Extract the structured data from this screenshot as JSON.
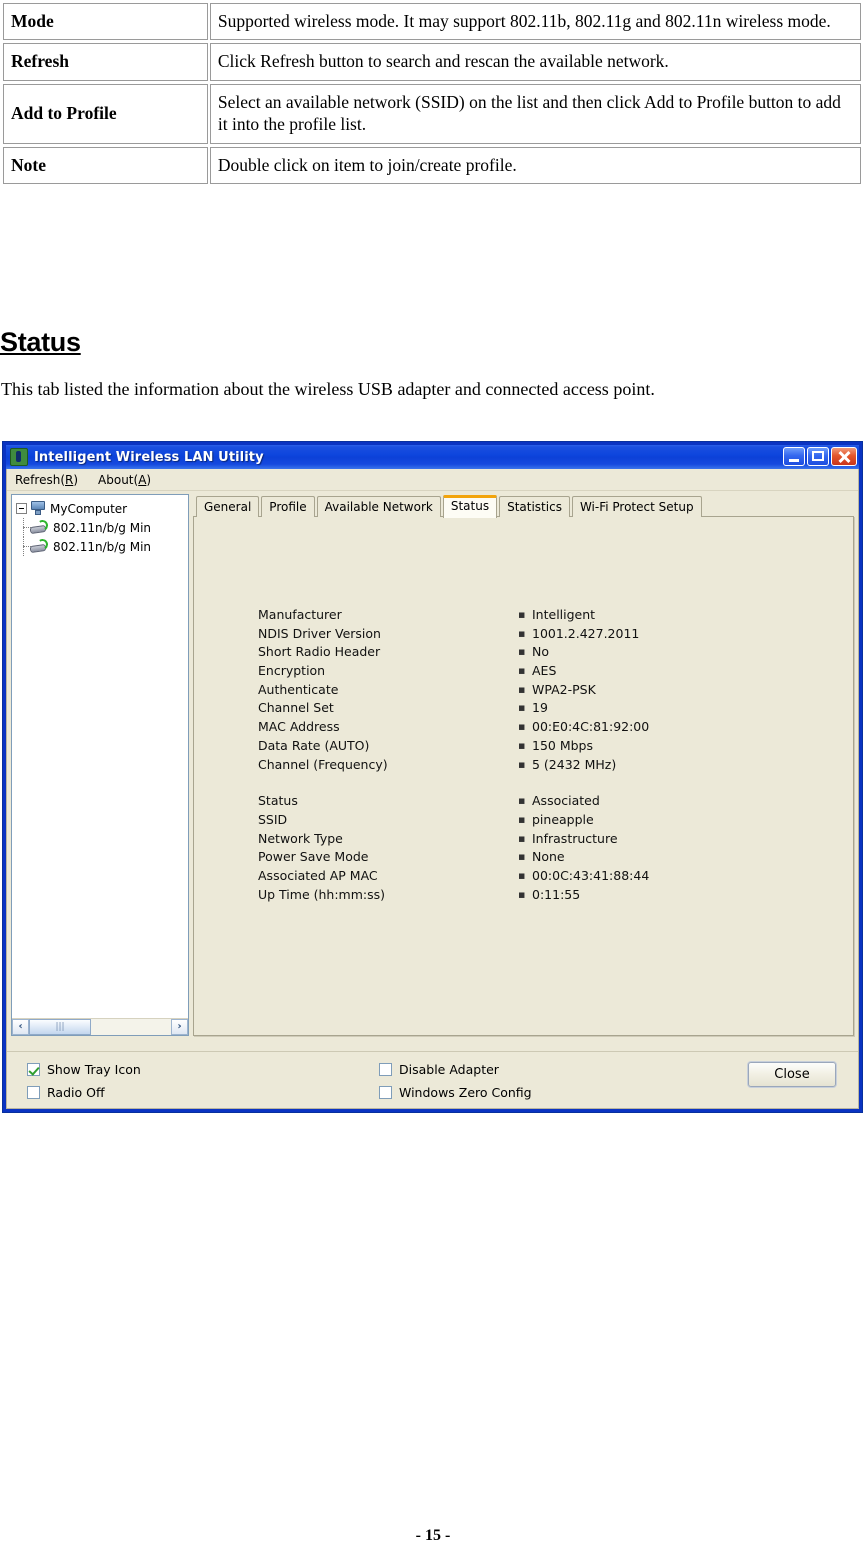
{
  "doc_table": {
    "rows": [
      {
        "term": "Mode",
        "description": "Supported wireless mode. It may support 802.11b, 802.11g and 802.11n wireless mode."
      },
      {
        "term": "Refresh",
        "description": "Click Refresh button to search and rescan the available network."
      },
      {
        "term": "Add to Profile",
        "description": "Select an available network (SSID) on the list and then click Add to Profile button to add it into the profile list."
      },
      {
        "term": "Note",
        "description": "Double click on item to join/create profile."
      }
    ]
  },
  "section": {
    "heading": "Status",
    "intro": "This tab listed the information about the wireless USB adapter and connected access point."
  },
  "app": {
    "title": "Intelligent Wireless LAN Utility",
    "window_buttons": {
      "minimize": "minimize-icon",
      "maximize": "maximize-icon",
      "close": "close-icon"
    },
    "menu": [
      {
        "label_pre": "Refresh(",
        "accel": "R",
        "label_post": ")"
      },
      {
        "label_pre": "About(",
        "accel": "A",
        "label_post": ")"
      }
    ],
    "tree": {
      "root": "MyComputer",
      "children": [
        "802.11n/b/g Min",
        "802.11n/b/g Min"
      ],
      "scrollbar": {
        "left_arrow": "‹",
        "right_arrow": "›",
        "grip": "|||"
      }
    },
    "tabs": [
      {
        "label": "General",
        "active": false
      },
      {
        "label": "Profile",
        "active": false
      },
      {
        "label": "Available Network",
        "active": false
      },
      {
        "label": "Status",
        "active": true
      },
      {
        "label": "Statistics",
        "active": false
      },
      {
        "label": "Wi-Fi Protect Setup",
        "active": false
      }
    ],
    "status_fields_group1": [
      {
        "label": "Manufacturer",
        "value": "Intelligent"
      },
      {
        "label": "NDIS Driver Version",
        "value": "1001.2.427.2011"
      },
      {
        "label": "Short Radio Header",
        "value": "No"
      },
      {
        "label": "Encryption",
        "value": "AES"
      },
      {
        "label": "Authenticate",
        "value": "WPA2-PSK"
      },
      {
        "label": "Channel Set",
        "value": "19"
      },
      {
        "label": "MAC Address",
        "value": "00:E0:4C:81:92:00"
      },
      {
        "label": "Data Rate (AUTO)",
        "value": "150 Mbps"
      },
      {
        "label": "Channel (Frequency)",
        "value": "5 (2432 MHz)"
      }
    ],
    "status_fields_group2": [
      {
        "label": "Status",
        "value": "Associated"
      },
      {
        "label": "SSID",
        "value": "pineapple"
      },
      {
        "label": "Network Type",
        "value": "Infrastructure"
      },
      {
        "label": "Power Save Mode",
        "value": "None"
      },
      {
        "label": "Associated AP MAC",
        "value": "00:0C:43:41:88:44"
      },
      {
        "label": "Up Time (hh:mm:ss)",
        "value": "0:11:55"
      }
    ],
    "value_separator": "▪",
    "checkboxes": [
      {
        "label": "Show Tray Icon",
        "checked": true
      },
      {
        "label": "Radio Off",
        "checked": false
      },
      {
        "label": "Disable Adapter",
        "checked": false
      },
      {
        "label": "Windows Zero Config",
        "checked": false
      }
    ],
    "close_button": "Close"
  },
  "footer": {
    "page_number": "- 15 -"
  },
  "colors": {
    "titlebar_blue": "#0d45dd",
    "window_chrome": "#ece9d8",
    "active_tab_accent": "#f2a40c",
    "checked_mark": "#2f9e2f",
    "close_button_red": "#c8351a"
  }
}
